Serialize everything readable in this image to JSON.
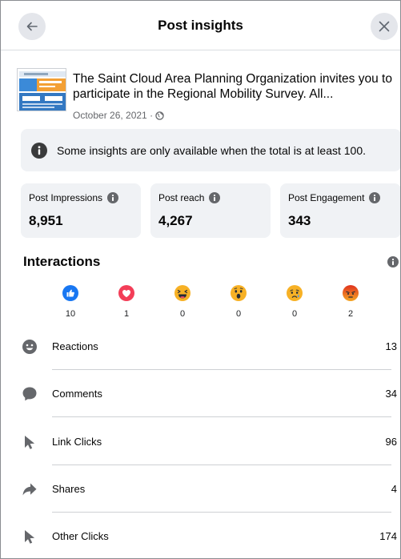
{
  "header": {
    "title": "Post insights"
  },
  "post": {
    "text_line1": "The Saint Cloud Area Planning Organization invites you to",
    "text_line2": "participate in the Regional Mobility Survey. All...",
    "date": "October 26, 2021 ·",
    "thumb_header_text": "Saint Cloud APO"
  },
  "banner": {
    "text": "Some insights are only available when the total is at least 100."
  },
  "stats": [
    {
      "label": "Post Impressions",
      "value": "8,951"
    },
    {
      "label": "Post reach",
      "value": "4,267"
    },
    {
      "label": "Post Engagement",
      "value": "343"
    }
  ],
  "interactions": {
    "title": "Interactions",
    "reactions": [
      {
        "name": "like-reaction-icon",
        "count": "10"
      },
      {
        "name": "love-reaction-icon",
        "count": "1"
      },
      {
        "name": "haha-reaction-icon",
        "count": "0"
      },
      {
        "name": "wow-reaction-icon",
        "count": "0"
      },
      {
        "name": "sad-reaction-icon",
        "count": "0"
      },
      {
        "name": "angry-reaction-icon",
        "count": "2"
      }
    ],
    "rows": [
      {
        "label": "Reactions",
        "value": "13",
        "icon": "smiley-icon"
      },
      {
        "label": "Comments",
        "value": "34",
        "icon": "comment-icon"
      },
      {
        "label": "Link Clicks",
        "value": "96",
        "icon": "cursor-icon"
      },
      {
        "label": "Shares",
        "value": "4",
        "icon": "share-icon"
      },
      {
        "label": "Other Clicks",
        "value": "174",
        "icon": "cursor-icon"
      }
    ]
  },
  "colors": {
    "like": "#1877f2",
    "love": "#f33e58",
    "yellow": "#f7b125",
    "angry": "#e9710f",
    "panel": "#f0f2f5",
    "icon": "#65676b"
  }
}
